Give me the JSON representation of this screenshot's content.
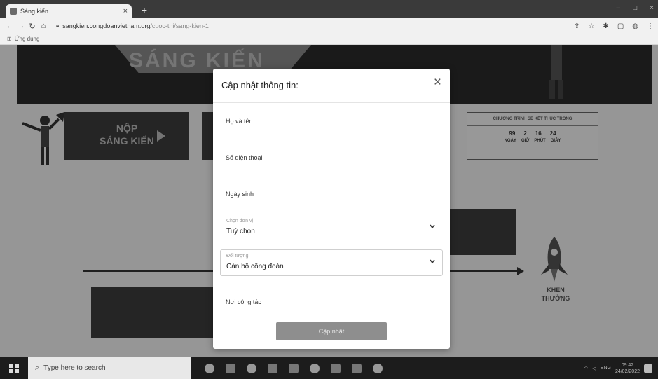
{
  "browser": {
    "tab_title": "Sáng kiến",
    "tab_close": "×",
    "new_tab": "+",
    "window_controls": [
      "–",
      "□",
      "×"
    ],
    "url_domain": "sangkien.congdoanvietnam.org",
    "url_path": "/cuoc-thi/sang-kien-1",
    "bookmarks_label": "Ứng dụng"
  },
  "page": {
    "banner_title": "SÁNG KIẾN",
    "submit_line1": "NỘP",
    "submit_line2": "SÁNG KIẾN",
    "countdown": {
      "heading": "CHƯƠNG TRÌNH SẼ KẾT THÚC TRONG",
      "values": [
        "99",
        "2",
        "16",
        "24"
      ],
      "units": [
        "NGÀY",
        "GIỜ",
        "PHÚT",
        "GIÂY"
      ]
    },
    "reward_line1": "KHEN",
    "reward_line2": "THƯỞNG"
  },
  "modal": {
    "title": "Cập nhật thông tin:",
    "close": "×",
    "fields": {
      "full_name": "Họ và tên",
      "phone": "Số điện thoại",
      "birthday": "Ngày sinh",
      "unit_label": "Chọn đơn vị",
      "unit_value": "Tuỳ chọn",
      "target_label": "Đối tượng",
      "target_value": "Cán bộ công đoàn",
      "workplace": "Nơi công tác"
    },
    "submit": "Cập nhật"
  },
  "taskbar": {
    "search_placeholder": "Type here to search",
    "time": "09:42",
    "date": "24/02/2022"
  }
}
